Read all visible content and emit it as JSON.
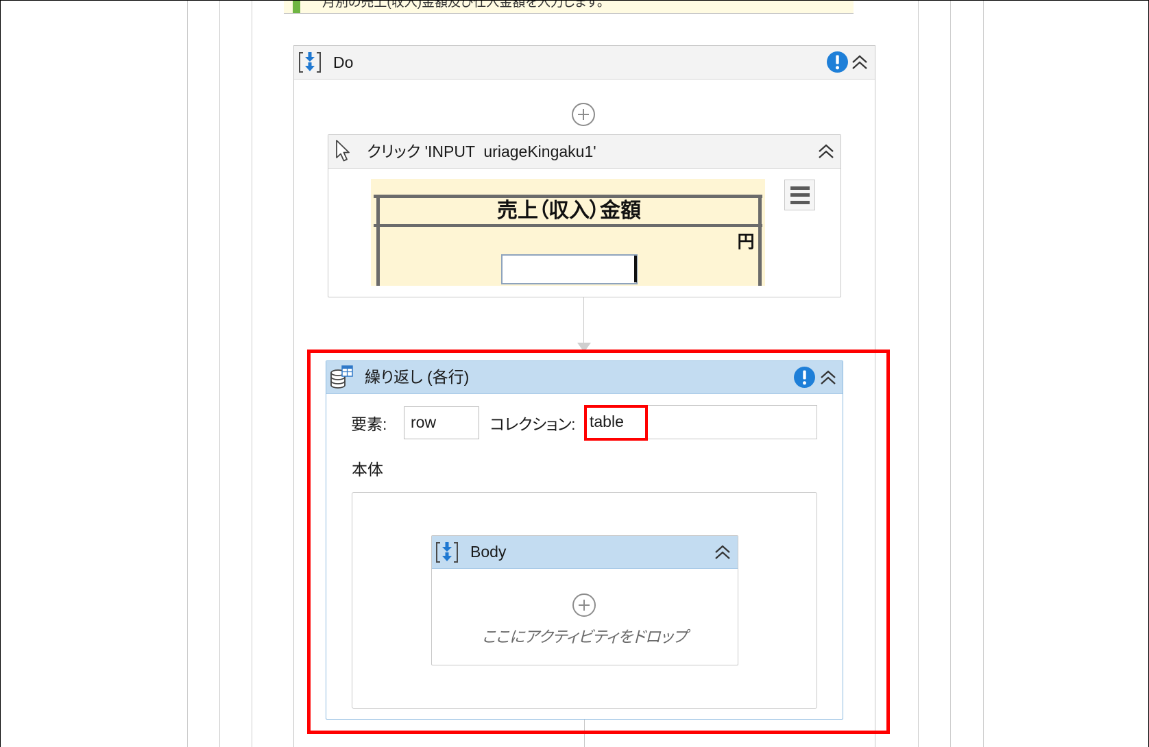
{
  "annotation": {
    "text": "月別の売上(収入)金額及び仕入金額を入力します。"
  },
  "do_sequence": {
    "title": "Do",
    "icon": "sequence-icon",
    "status_icon": "warning-icon",
    "collapse_icon": "double-chevron-up-icon",
    "add_icon": "add-activity-icon"
  },
  "click_activity": {
    "title": "クリック 'INPUT  uriageKingaku1'",
    "icon": "mouse-pointer-icon",
    "collapse_icon": "double-chevron-up-icon",
    "menu_icon": "hamburger-menu-icon",
    "screenshot": {
      "heading": "売上（収入）金額",
      "unit": "円"
    }
  },
  "for_each": {
    "title": "繰り返し (各行)",
    "icon": "data-table-icon",
    "status_icon": "warning-icon",
    "collapse_icon": "double-chevron-up-icon",
    "item_label": "要素:",
    "item_value": "row",
    "collection_label": "コレクション:",
    "collection_value": "table",
    "body_label": "本体",
    "body": {
      "title": "Body",
      "icon": "sequence-icon",
      "collapse_icon": "double-chevron-up-icon",
      "add_icon": "add-activity-icon",
      "drop_hint": "ここにアクティビティをドロップ"
    }
  },
  "colors": {
    "highlight": "#ff0000",
    "foreach_header": "#c3dcf1",
    "warning": "#1e7fd8",
    "annotation_marker": "#6fb543",
    "annotation_background": "#fffbe2",
    "screenshot_background": "#fef5d4"
  }
}
